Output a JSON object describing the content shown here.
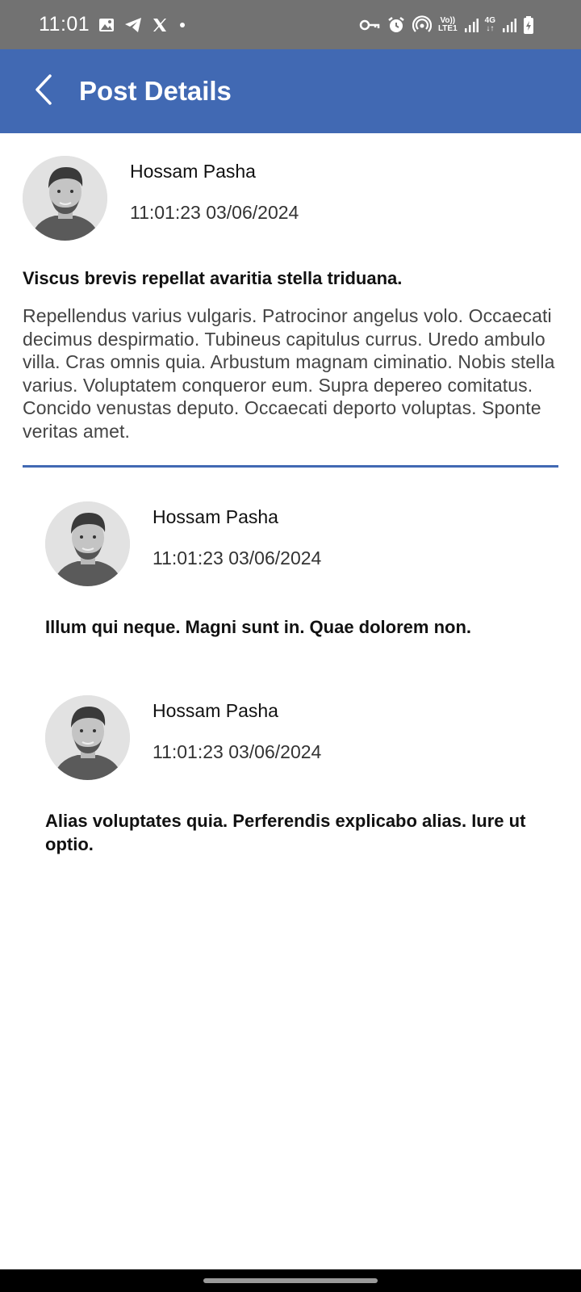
{
  "status_bar": {
    "time": "11:01",
    "left_icons": [
      "image-icon",
      "telegram-icon",
      "x-icon",
      "dot-icon"
    ],
    "volte_label_top": "Vo))",
    "volte_label_bottom": "LTE1",
    "network_label": "4G",
    "right_icons": [
      "vpn-key-icon",
      "alarm-icon",
      "hotspot-icon",
      "signal-icon",
      "signal-icon",
      "battery-charging-icon"
    ]
  },
  "app_bar": {
    "title": "Post Details",
    "back_icon": "chevron-left-icon",
    "color": "#4169b3"
  },
  "post": {
    "author": "Hossam Pasha",
    "timestamp": "11:01:23 03/06/2024",
    "title": "Viscus brevis repellat avaritia stella triduana.",
    "body": "Repellendus varius vulgaris. Patrocinor angelus volo. Occaecati decimus despirmatio. Tubineus capitulus currus. Uredo ambulo villa. Cras omnis quia. Arbustum magnam ciminatio. Nobis stella varius. Voluptatem conqueror eum. Supra depereo comitatus. Concido venustas deputo. Occaecati deporto voluptas. Sponte veritas amet."
  },
  "comments": [
    {
      "author": "Hossam Pasha",
      "timestamp": "11:01:23 03/06/2024",
      "text": "Illum qui neque. Magni sunt in. Quae dolorem non."
    },
    {
      "author": "Hossam Pasha",
      "timestamp": "11:01:23 03/06/2024",
      "text": "Alias voluptates quia. Perferendis explicabo alias. Iure ut optio."
    }
  ]
}
